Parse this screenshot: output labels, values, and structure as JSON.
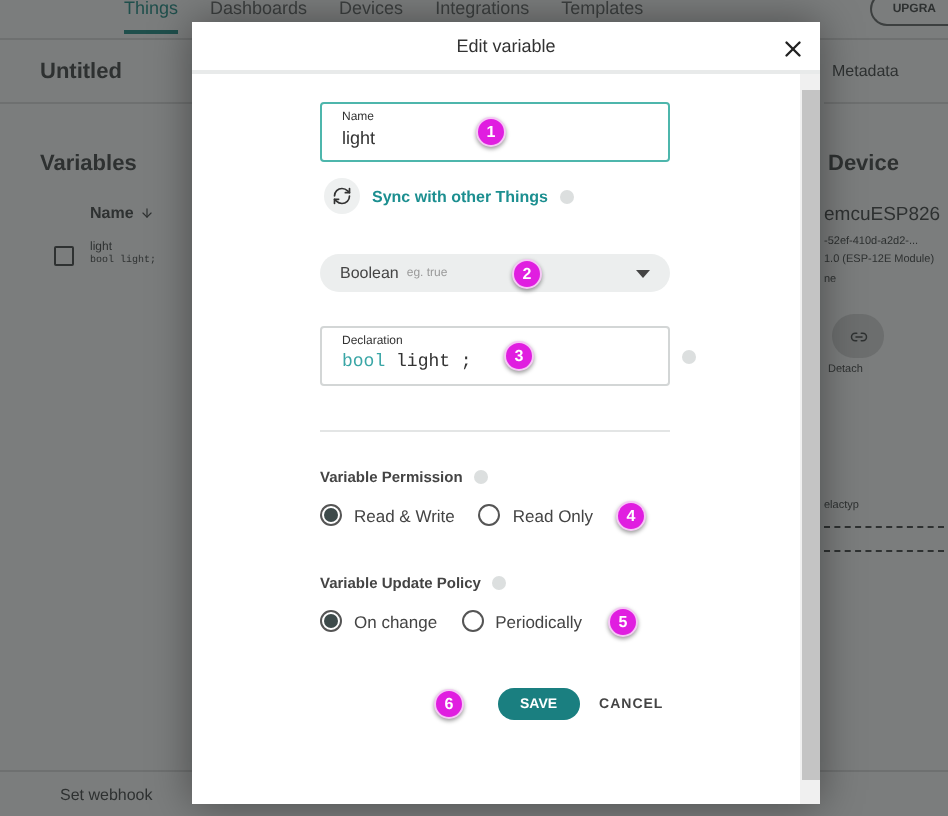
{
  "nav": {
    "tabs": [
      {
        "label": "Things",
        "selected": true
      },
      {
        "label": "Dashboards",
        "selected": false
      },
      {
        "label": "Devices",
        "selected": false
      },
      {
        "label": "Integrations",
        "selected": false
      },
      {
        "label": "Templates",
        "selected": false
      }
    ],
    "upgrade_button": "UPGRA"
  },
  "thing": {
    "title": "Untitled",
    "right_tab": "Metadata"
  },
  "variables": {
    "title": "Variables",
    "column": "Name",
    "rows": [
      {
        "name": "light",
        "declaration": "bool light;",
        "checked": false
      }
    ]
  },
  "device": {
    "title": "Device",
    "name": "emcuESP826",
    "id": "-52ef-410d-a2d2-...",
    "board": "1.0 (ESP-12E Module)",
    "status": "ne",
    "detach": "Detach",
    "property": "elactyp"
  },
  "footer": {
    "webhook": "Set webhook"
  },
  "dialog": {
    "title": "Edit variable",
    "name_field": {
      "label": "Name",
      "value": "light",
      "marker": "1"
    },
    "sync": {
      "label": "Sync with other Things"
    },
    "type_select": {
      "value": "Boolean",
      "hint": "eg. true",
      "marker": "2"
    },
    "declaration": {
      "label": "Declaration",
      "keyword": "bool",
      "rest": "light ;",
      "marker": "3"
    },
    "permission": {
      "title": "Variable Permission",
      "marker": "4",
      "options": [
        {
          "label": "Read & Write",
          "selected": true
        },
        {
          "label": "Read Only",
          "selected": false
        }
      ]
    },
    "update_policy": {
      "title": "Variable Update Policy",
      "marker": "5",
      "options": [
        {
          "label": "On change",
          "selected": true
        },
        {
          "label": "Periodically",
          "selected": false
        }
      ]
    },
    "buttons": {
      "save": "SAVE",
      "cancel": "CANCEL",
      "marker": "6"
    }
  }
}
